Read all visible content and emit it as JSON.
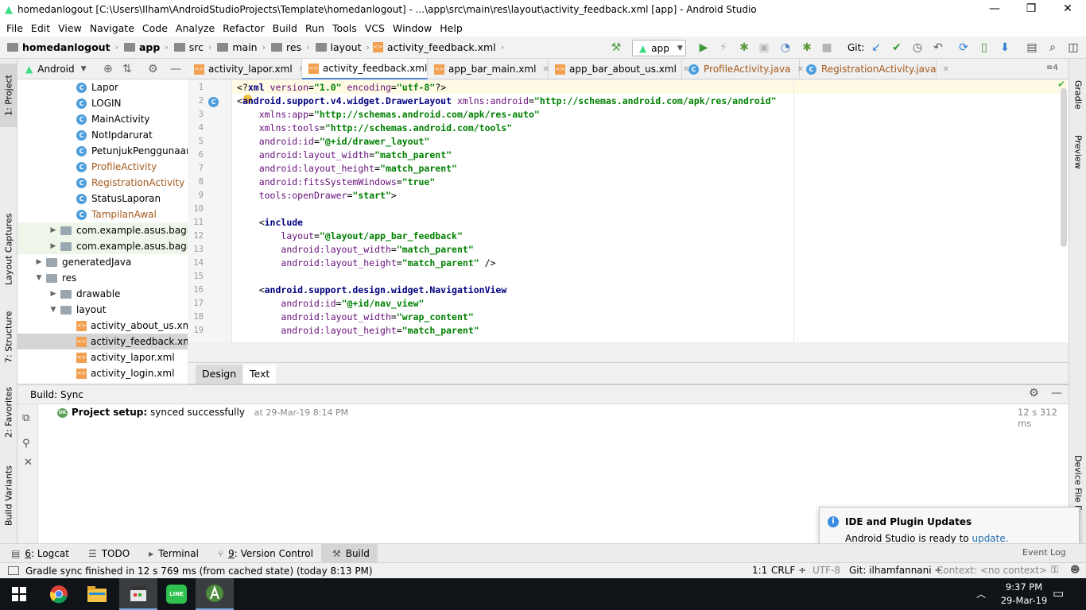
{
  "window": {
    "title": "homedanlogout [C:\\Users\\Ilham\\AndroidStudioProjects\\Template\\homedanlogout] - ...\\app\\src\\main\\res\\layout\\activity_feedback.xml [app] - Android Studio",
    "minimize": "—",
    "restore": "❐",
    "close": "✕"
  },
  "menu": [
    "File",
    "Edit",
    "View",
    "Navigate",
    "Code",
    "Analyze",
    "Refactor",
    "Build",
    "Run",
    "Tools",
    "VCS",
    "Window",
    "Help"
  ],
  "breadcrumbs": [
    "homedanlogout",
    "app",
    "src",
    "main",
    "res",
    "layout",
    "activity_feedback.xml"
  ],
  "toolbar": {
    "run_config": "app",
    "vcs_label": "Git:"
  },
  "left_strip": {
    "project": "1: Project",
    "captures": "Layout Captures",
    "structure": "7: Structure",
    "favorites": "2: Favorites",
    "variants": "Build Variants"
  },
  "right_strip": {
    "gradle": "Gradle",
    "preview": "Preview",
    "device": "Device File Ex"
  },
  "project_panel": {
    "view_label": "Android",
    "tree": [
      {
        "label": "Lapor",
        "type": "class",
        "depth": 2,
        "color": "#000000"
      },
      {
        "label": "LOGIN",
        "type": "class",
        "depth": 2,
        "color": "#000000"
      },
      {
        "label": "MainActivity",
        "type": "class",
        "depth": 2,
        "color": "#000000"
      },
      {
        "label": "NotIpdarurat",
        "type": "class",
        "depth": 2,
        "color": "#000000"
      },
      {
        "label": "PetunjukPenggunaan",
        "type": "class",
        "depth": 2,
        "color": "#000000"
      },
      {
        "label": "ProfileActivity",
        "type": "class",
        "depth": 2,
        "color": "#a55a1c"
      },
      {
        "label": "RegistrationActivity",
        "type": "class",
        "depth": 2,
        "color": "#a55a1c"
      },
      {
        "label": "StatusLaporan",
        "type": "class",
        "depth": 2,
        "color": "#000000"
      },
      {
        "label": "TampilanAwal",
        "type": "class",
        "depth": 2,
        "color": "#a55a1c"
      },
      {
        "label": "com.example.asus.bagiani",
        "type": "package",
        "depth": 1,
        "color": "#000000"
      },
      {
        "label": "com.example.asus.bagiani",
        "type": "package",
        "depth": 1,
        "color": "#000000"
      },
      {
        "label": "generatedJava",
        "type": "folder",
        "depth": 0,
        "color": "#000000"
      },
      {
        "label": "res",
        "type": "folder-open",
        "depth": 0,
        "color": "#000000"
      },
      {
        "label": "drawable",
        "type": "folder",
        "depth": 1,
        "color": "#000000"
      },
      {
        "label": "layout",
        "type": "folder-open",
        "depth": 1,
        "color": "#000000"
      },
      {
        "label": "activity_about_us.xml",
        "type": "xml",
        "depth": 2,
        "color": "#000000"
      },
      {
        "label": "activity_feedback.xml",
        "type": "xml",
        "depth": 2,
        "color": "#000000"
      },
      {
        "label": "activity_lapor.xml",
        "type": "xml",
        "depth": 2,
        "color": "#000000"
      },
      {
        "label": "activity_login.xml",
        "type": "xml",
        "depth": 2,
        "color": "#000000"
      }
    ]
  },
  "editor_tabs": [
    {
      "label": "activity_lapor.xml",
      "icon": "xml",
      "color": "#000000"
    },
    {
      "label": "activity_feedback.xml",
      "icon": "xml",
      "color": "#000000"
    },
    {
      "label": "app_bar_main.xml",
      "icon": "xml",
      "color": "#000000"
    },
    {
      "label": "app_bar_about_us.xml",
      "icon": "xml",
      "color": "#000000"
    },
    {
      "label": "ProfileActivity.java",
      "icon": "class",
      "color": "#a55a1c"
    },
    {
      "label": "RegistrationActivity.java",
      "icon": "class",
      "color": "#a55a1c"
    }
  ],
  "tab_overflow": "≡4",
  "code_lines": [
    {
      "n": "1",
      "parts": [
        [
          "plain",
          "<?"
        ],
        [
          "tg",
          "xml "
        ],
        [
          "at",
          "version"
        ],
        [
          "plain",
          "="
        ],
        [
          "vl",
          "\"1.0\""
        ],
        [
          "plain",
          " "
        ],
        [
          "at",
          "encoding"
        ],
        [
          "plain",
          "="
        ],
        [
          "vl",
          "\"utf-8\""
        ],
        [
          "plain",
          "?>"
        ]
      ]
    },
    {
      "n": "2",
      "parts": [
        [
          "plain",
          "<"
        ],
        [
          "tg",
          "android.support.v4.widget.DrawerLayout "
        ],
        [
          "at",
          "xmlns:android"
        ],
        [
          "plain",
          "="
        ],
        [
          "vl",
          "\"http://schemas.android.com/apk/res/android\""
        ]
      ]
    },
    {
      "n": "3",
      "parts": [
        [
          "plain",
          "    "
        ],
        [
          "at",
          "xmlns:app"
        ],
        [
          "plain",
          "="
        ],
        [
          "vl",
          "\"http://schemas.android.com/apk/res-auto\""
        ]
      ]
    },
    {
      "n": "4",
      "parts": [
        [
          "plain",
          "    "
        ],
        [
          "at",
          "xmlns:tools"
        ],
        [
          "plain",
          "="
        ],
        [
          "vl",
          "\"http://schemas.android.com/tools\""
        ]
      ]
    },
    {
      "n": "5",
      "parts": [
        [
          "plain",
          "    "
        ],
        [
          "at",
          "android:id"
        ],
        [
          "plain",
          "="
        ],
        [
          "vl",
          "\"@+id/drawer_layout\""
        ]
      ]
    },
    {
      "n": "6",
      "parts": [
        [
          "plain",
          "    "
        ],
        [
          "at",
          "android:layout_width"
        ],
        [
          "plain",
          "="
        ],
        [
          "vl",
          "\"match_parent\""
        ]
      ]
    },
    {
      "n": "7",
      "parts": [
        [
          "plain",
          "    "
        ],
        [
          "at",
          "android:layout_height"
        ],
        [
          "plain",
          "="
        ],
        [
          "vl",
          "\"match_parent\""
        ]
      ]
    },
    {
      "n": "8",
      "parts": [
        [
          "plain",
          "    "
        ],
        [
          "at",
          "android:fitsSystemWindows"
        ],
        [
          "plain",
          "="
        ],
        [
          "vl",
          "\"true\""
        ]
      ]
    },
    {
      "n": "9",
      "parts": [
        [
          "plain",
          "    "
        ],
        [
          "at",
          "tools:openDrawer"
        ],
        [
          "plain",
          "="
        ],
        [
          "vl",
          "\"start\""
        ],
        [
          "plain",
          ">"
        ]
      ]
    },
    {
      "n": "10",
      "parts": []
    },
    {
      "n": "11",
      "parts": [
        [
          "plain",
          "    <"
        ],
        [
          "tg",
          "include"
        ]
      ]
    },
    {
      "n": "12",
      "parts": [
        [
          "plain",
          "        "
        ],
        [
          "at",
          "layout"
        ],
        [
          "plain",
          "="
        ],
        [
          "vl",
          "\"@layout/app_bar_feedback\""
        ]
      ]
    },
    {
      "n": "13",
      "parts": [
        [
          "plain",
          "        "
        ],
        [
          "at",
          "android:layout_width"
        ],
        [
          "plain",
          "="
        ],
        [
          "vl",
          "\"match_parent\""
        ]
      ]
    },
    {
      "n": "14",
      "parts": [
        [
          "plain",
          "        "
        ],
        [
          "at",
          "android:layout_height"
        ],
        [
          "plain",
          "="
        ],
        [
          "vl",
          "\"match_parent\""
        ],
        [
          "plain",
          " />"
        ]
      ]
    },
    {
      "n": "15",
      "parts": []
    },
    {
      "n": "16",
      "parts": [
        [
          "plain",
          "    <"
        ],
        [
          "tg",
          "android.support.design.widget.NavigationView"
        ]
      ]
    },
    {
      "n": "17",
      "parts": [
        [
          "plain",
          "        "
        ],
        [
          "at",
          "android:id"
        ],
        [
          "plain",
          "="
        ],
        [
          "vl",
          "\"@+id/nav_view\""
        ]
      ]
    },
    {
      "n": "18",
      "parts": [
        [
          "plain",
          "        "
        ],
        [
          "at",
          "android:layout_width"
        ],
        [
          "plain",
          "="
        ],
        [
          "vl",
          "\"wrap_content\""
        ]
      ]
    },
    {
      "n": "19",
      "parts": [
        [
          "plain",
          "        "
        ],
        [
          "at",
          "android:layout_height"
        ],
        [
          "plain",
          "="
        ],
        [
          "vl",
          "\"match_parent\""
        ]
      ]
    }
  ],
  "design_tabs": {
    "design": "Design",
    "text": "Text"
  },
  "build": {
    "header": "Build: Sync",
    "badge": "OK",
    "message_bold": "Project setup:",
    "message": "synced successfully",
    "when": "at 29-Mar-19 8:14 PM",
    "duration": "12 s 312 ms"
  },
  "bottom_tabs": [
    {
      "key": "6",
      "label": ": Logcat"
    },
    {
      "key": "",
      "label": "TODO"
    },
    {
      "key": "",
      "label": "Terminal"
    },
    {
      "key": "9",
      "label": ": Version Control"
    },
    {
      "key": "",
      "label": "Build"
    }
  ],
  "event_log": "Event Log",
  "notification": {
    "title": "IDE and Plugin Updates",
    "body": "Android Studio is ready to",
    "link": "update."
  },
  "status": {
    "message": "Gradle sync finished in 12 s 769 ms (from cached state) (today 8:13 PM)",
    "position": "1:1",
    "line_sep": "CRLF ÷",
    "encoding": "UTF-8",
    "git": "Git: ilhamfannani ÷",
    "context": "Context: <no context>"
  },
  "taskbar": {
    "time": "9:37 PM",
    "date": "29-Mar-19",
    "line_label": "LINE"
  },
  "colors": {
    "accent_blue": "#4c9fdc",
    "taskbar": "#101317",
    "selected_row": "#d5d5d5",
    "modified_file": "#a55a1c"
  }
}
